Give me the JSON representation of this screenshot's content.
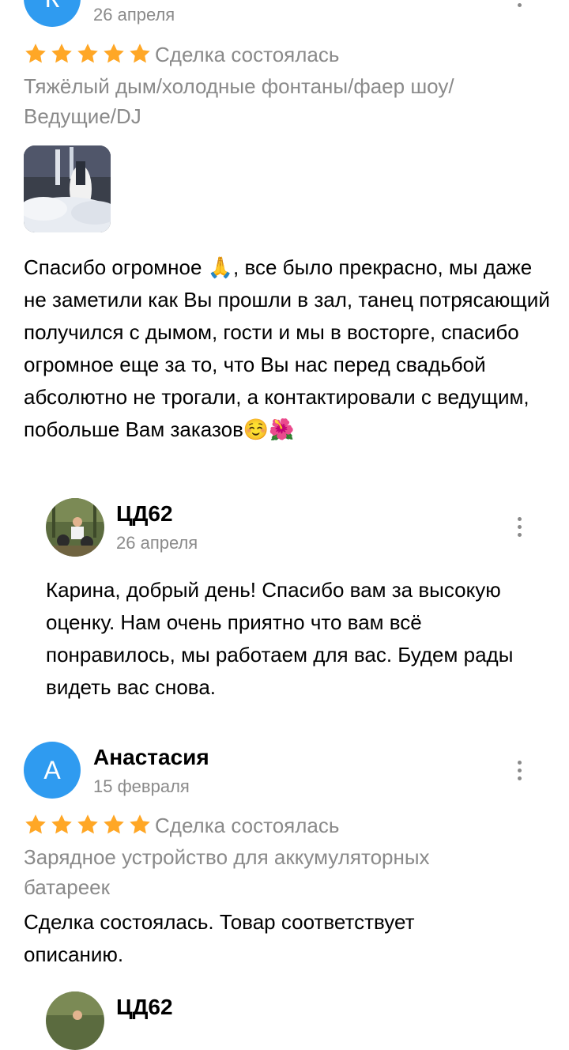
{
  "review1": {
    "avatar_letter": "К",
    "date": "26 апреля",
    "status": "Сделка состоялась",
    "item": "Тяжёлый дым/холодные фонтаны/фаер шоу/ Ведущие/DJ",
    "text": "Спасибо огромное 🙏, все было прекрасно, мы даже не заметили как Вы прошли в зал, танец потрясающий получился с дымом, гости и мы в восторге, спасибо огромное еще за то, что Вы нас перед свадьбой абсолютно не трогали, а контактировали с ведущим, побольше Вам заказов☺️🌺",
    "reply": {
      "name": "ЦД62",
      "date": "26 апреля",
      "text": "Карина, добрый день! Спасибо вам за высокую оценку. Нам очень приятно что вам всё понравилось, мы работаем для вас. Будем рады видеть вас снова."
    }
  },
  "review2": {
    "avatar_letter": "А",
    "name": "Анастасия",
    "date": "15 февраля",
    "status": "Сделка состоялась",
    "item": "Зарядное устройство для аккумуляторных батареек",
    "text": "Сделка состоялась. Товар соответствует описанию.",
    "reply": {
      "name": "ЦД62"
    }
  },
  "colors": {
    "accent": "#2f9bf0",
    "star": "#ffa726",
    "muted": "#8a8a8a"
  },
  "rating_stars": 5
}
